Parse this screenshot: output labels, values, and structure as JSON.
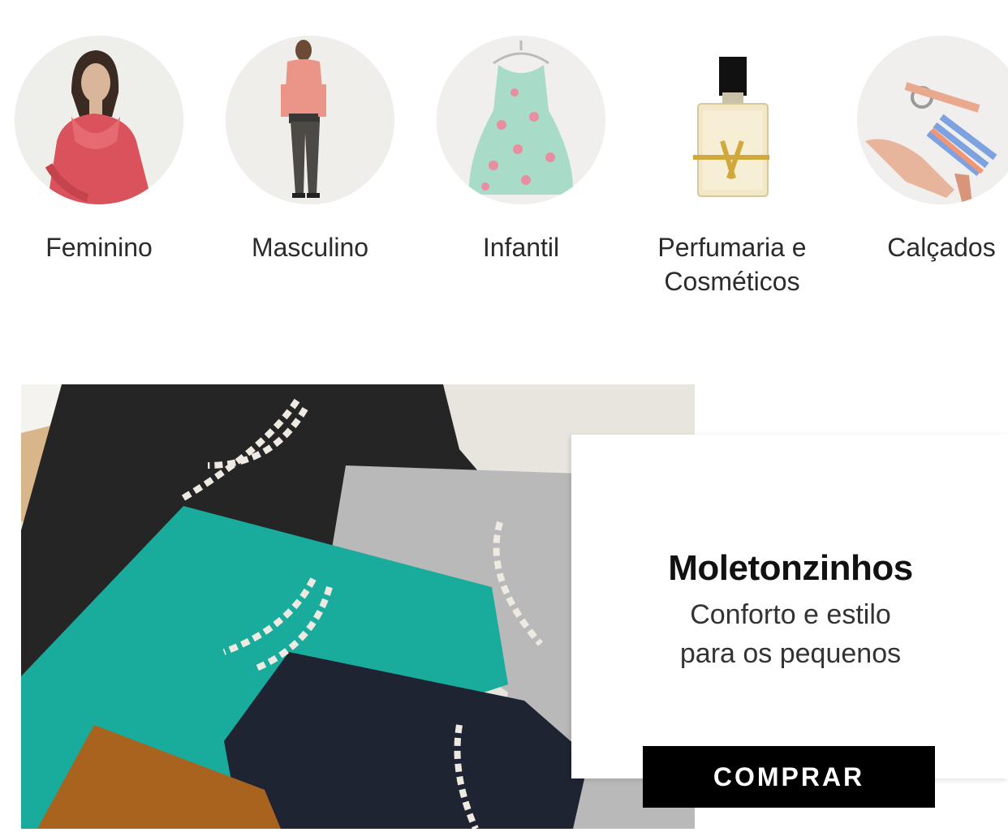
{
  "categories": [
    {
      "label": "Feminino",
      "image": "woman-pink-blouse-photo"
    },
    {
      "label": "Masculino",
      "image": "man-pink-jacket-photo"
    },
    {
      "label": "Infantil",
      "image": "floral-kids-dress-photo"
    },
    {
      "label": "Perfumaria e Cosméticos",
      "image": "perfume-bottle-photo"
    },
    {
      "label": "Calçados",
      "image": "strappy-sandal-photo"
    }
  ],
  "promo": {
    "title": "Moletonzinhos",
    "subtitle_line1": "Conforto e estilo",
    "subtitle_line2": "para os pequenos",
    "cta_label": "COMPRAR",
    "image": "kids-sweatpants-photo"
  },
  "colors": {
    "cta_background": "#000000",
    "cta_text": "#ffffff",
    "circle_background": "#efefed"
  }
}
